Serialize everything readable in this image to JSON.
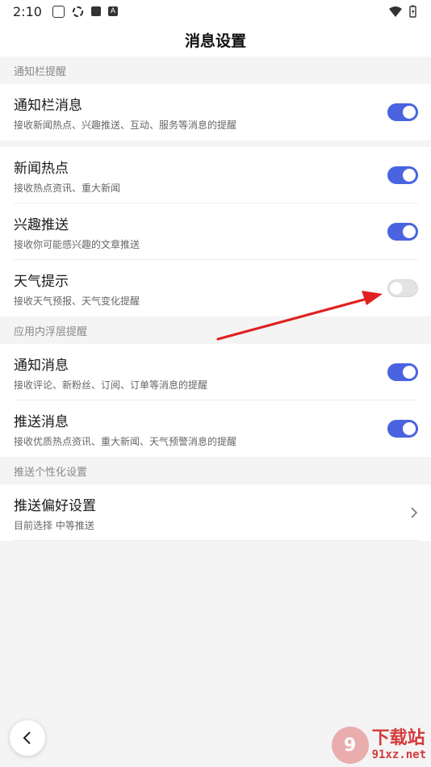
{
  "status_bar": {
    "time": "2:10",
    "icons": [
      "paw-icon",
      "sync-icon",
      "square-icon",
      "letter-a-icon",
      "wifi-icon",
      "battery-icon"
    ],
    "letter": "A"
  },
  "header": {
    "title": "消息设置"
  },
  "sections": {
    "notification_bar": {
      "label": "通知栏提醒",
      "items": [
        {
          "title": "通知栏消息",
          "subtitle": "接收新闻热点、兴趣推送、互动、服务等消息的提醒",
          "enabled": true
        }
      ]
    },
    "content": {
      "items": [
        {
          "title": "新闻热点",
          "subtitle": "接收热点资讯、重大新闻",
          "enabled": true
        },
        {
          "title": "兴趣推送",
          "subtitle": "接收你可能感兴趣的文章推送",
          "enabled": true
        },
        {
          "title": "天气提示",
          "subtitle": "接收天气预报、天气变化提醒",
          "enabled": false
        }
      ]
    },
    "in_app": {
      "label": "应用内浮层提醒",
      "items": [
        {
          "title": "通知消息",
          "subtitle": "接收评论、新粉丝、订阅、订单等消息的提醒",
          "enabled": true
        },
        {
          "title": "推送消息",
          "subtitle": "接收优质热点资讯、重大新闻、天气预警消息的提醒",
          "enabled": true
        }
      ]
    },
    "personalization": {
      "label": "推送个性化设置",
      "items": [
        {
          "title": "推送偏好设置",
          "subtitle": "目前选择 中等推送"
        }
      ]
    }
  },
  "colors": {
    "accent": "#4a63e0",
    "toggle_off": "#e3e3e3",
    "annotation_arrow": "#e02020",
    "watermark": "#d43a3a"
  },
  "watermark": {
    "brand": "下载站",
    "site": "91xz.net",
    "logo": "9"
  }
}
